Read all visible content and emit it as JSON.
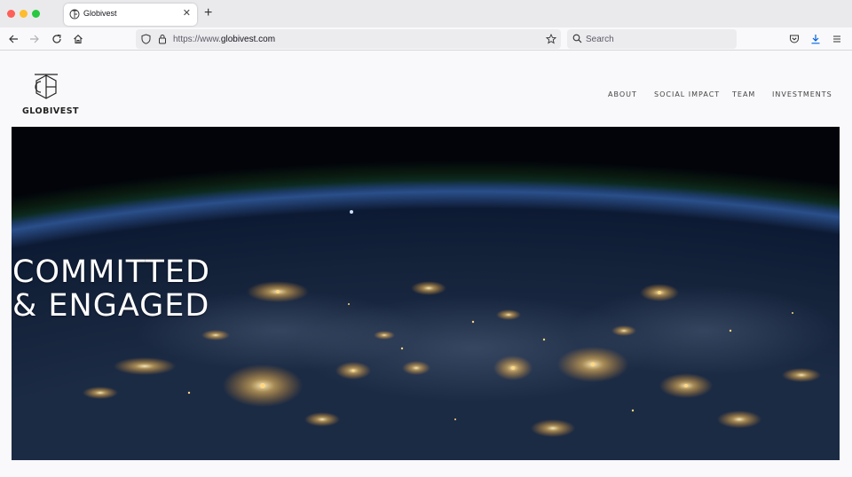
{
  "browser": {
    "tab_title": "Globivest",
    "url_prefix": "https://www.",
    "url_host": "globivest.com",
    "search_placeholder": "Search"
  },
  "site": {
    "logo_text": "GLOBIVEST",
    "nav": [
      "ABOUT",
      "SOCIAL IMPACT",
      "TEAM",
      "INVESTMENTS"
    ],
    "hero_line1": "COMMITTED",
    "hero_line2": "& ENGAGED"
  },
  "colors": {
    "traffic_red": "#fe5f57",
    "traffic_yellow": "#febc2e",
    "traffic_green": "#28c840",
    "download_accent": "#0060df"
  },
  "icons": [
    "back-icon",
    "forward-icon",
    "reload-icon",
    "home-icon",
    "shield-icon",
    "lock-icon",
    "bookmark-star-icon",
    "search-icon",
    "pocket-icon",
    "download-icon",
    "menu-icon"
  ]
}
